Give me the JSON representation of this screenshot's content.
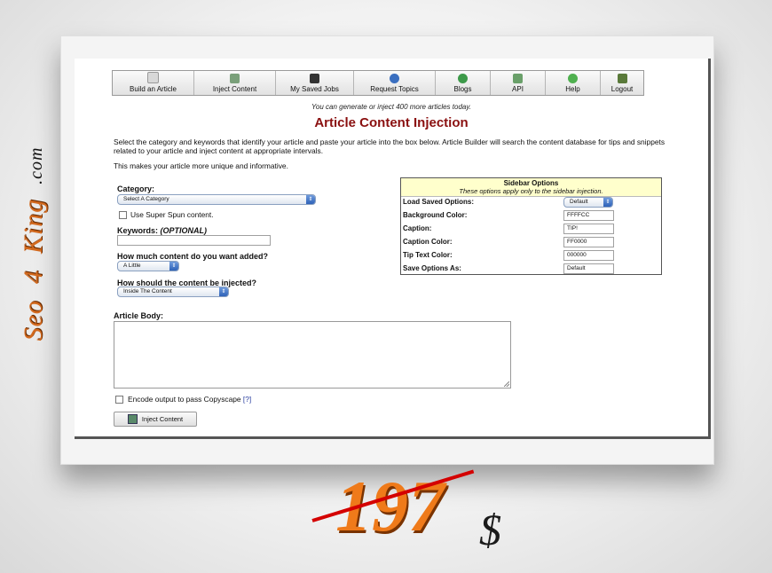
{
  "nav": [
    {
      "label": "Build an Article",
      "icon": "document-icon",
      "color": "#d8d8d8"
    },
    {
      "label": "Inject Content",
      "icon": "inject-icon",
      "color": "#7aa07a"
    },
    {
      "label": "My Saved Jobs",
      "icon": "disk-icon",
      "color": "#333333"
    },
    {
      "label": "Request Topics",
      "icon": "info-icon",
      "color": "#3a6fc0"
    },
    {
      "label": "Blogs",
      "icon": "globe-icon",
      "color": "#3d9a4a"
    },
    {
      "label": "API",
      "icon": "api-icon",
      "color": "#6aa06a"
    },
    {
      "label": "Help",
      "icon": "help-icon",
      "color": "#4fb04f"
    },
    {
      "label": "Logout",
      "icon": "logout-icon",
      "color": "#5a7a3a"
    }
  ],
  "notice": "You can generate or inject 400 more articles today.",
  "title": "Article Content Injection",
  "description": "Select the category and keywords that identify your article and paste your article into the box below. Article Builder will search the content database for tips and snippets related to your article and inject content at appropriate intervals.",
  "description2": "This makes your article more unique and informative.",
  "form": {
    "category_label": "Category:",
    "category_value": "Select A Category",
    "superspun_label": "Use Super Spun content.",
    "keywords_label": "Keywords:",
    "keywords_optional": "(OPTIONAL)",
    "amount_label": "How much content do you want added?",
    "amount_value": "A Little",
    "position_label": "How should the content be injected?",
    "position_value": "Inside The Content",
    "body_label": "Article Body:",
    "encode_label": "Encode output to pass Copyscape",
    "encode_help": "[?]",
    "submit_label": "Inject Content"
  },
  "sidebar": {
    "title": "Sidebar Options",
    "subtitle": "These options apply only to the sidebar injection.",
    "load_label": "Load Saved Options:",
    "load_value": "Default",
    "bg_label": "Background Color:",
    "bg_value": "FFFFCC",
    "caption_label": "Caption:",
    "caption_value": "TIP!",
    "caption_color_label": "Caption Color:",
    "caption_color_value": "FF0000",
    "tip_color_label": "Tip Text Color:",
    "tip_color_value": "000000",
    "save_as_label": "Save Options As:",
    "save_as_value": "Default"
  },
  "promo": {
    "brand_seo": "Seo",
    "brand_4": "4",
    "brand_king": "King",
    "brand_com": ".com",
    "price": "197",
    "currency": "$"
  }
}
